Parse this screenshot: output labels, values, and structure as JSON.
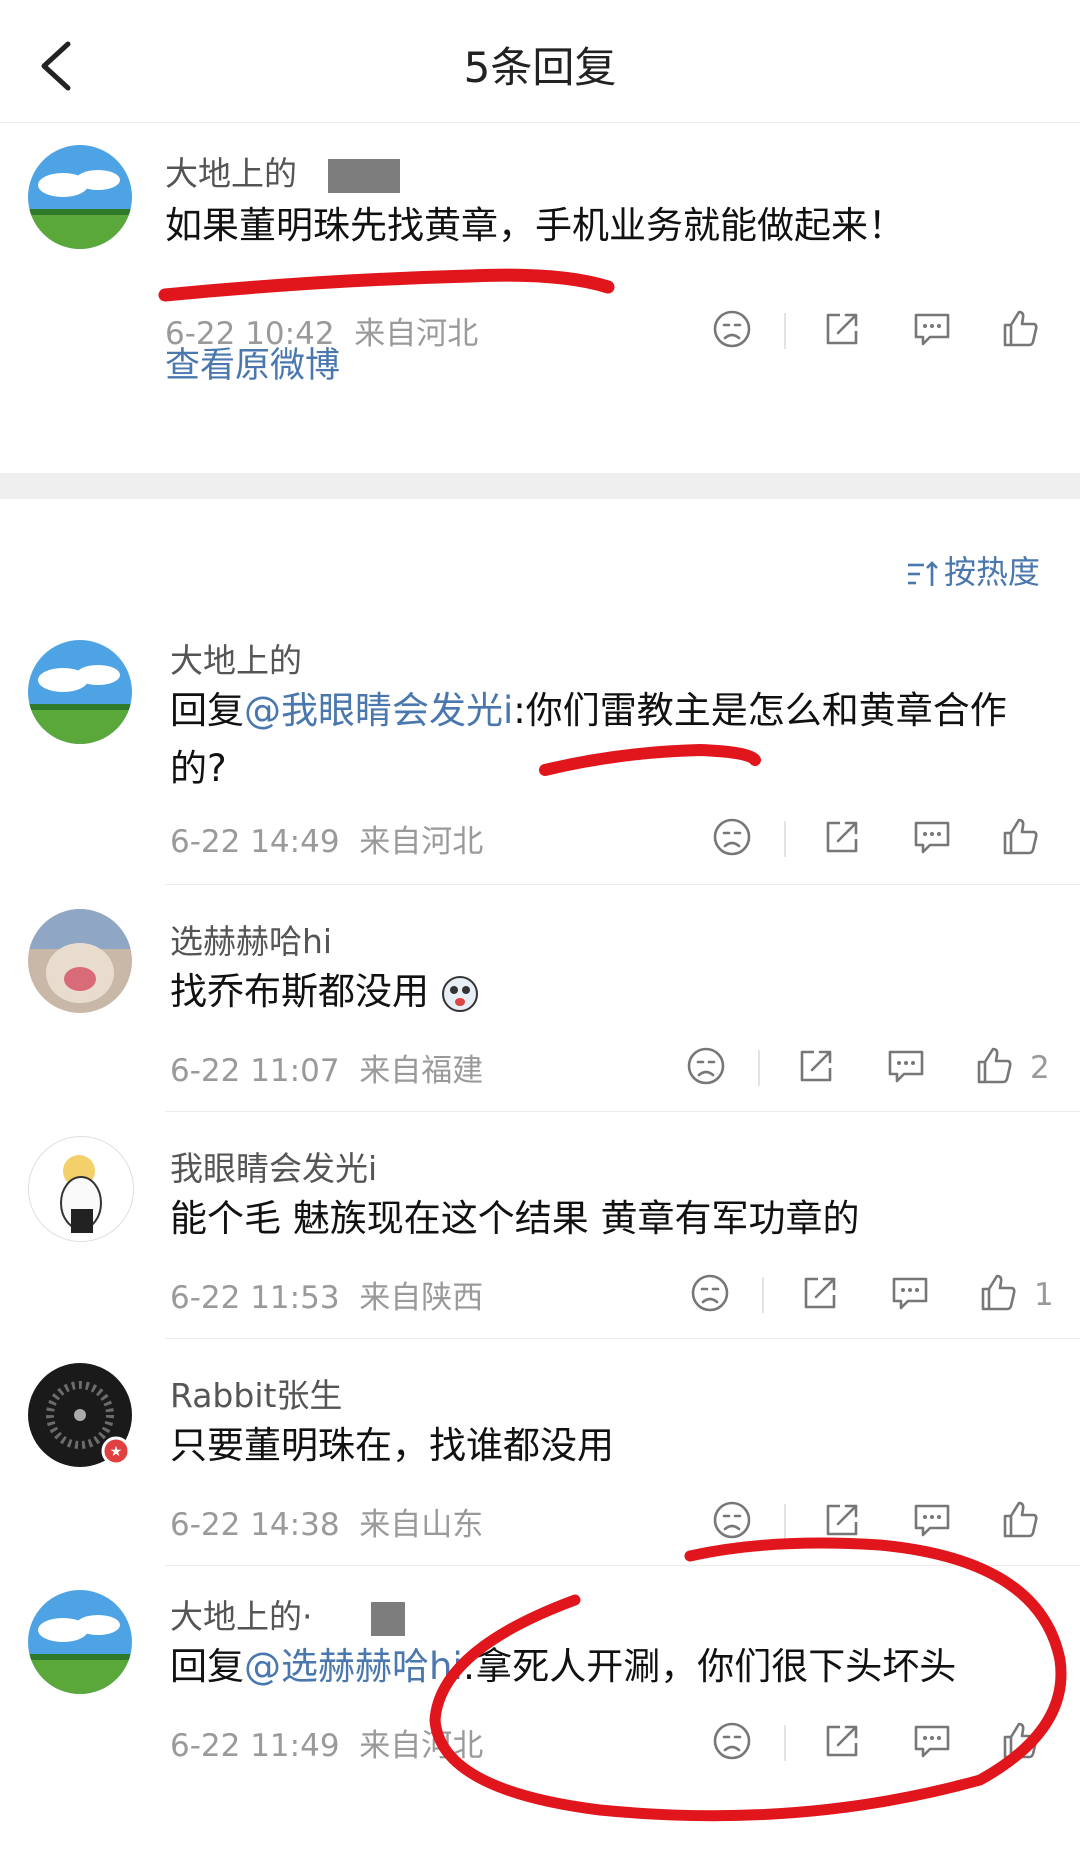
{
  "header": {
    "title": "5条回复"
  },
  "post": {
    "username": "大地上的",
    "content": "如果董明珠先找黄章，手机业务就能做起来！",
    "time": "6-22 10:42",
    "location": "来自河北",
    "view_original": "查看原微博"
  },
  "sort": {
    "label": "按热度"
  },
  "replies": [
    {
      "username": "大地上的",
      "reply_prefix": "回复",
      "mention": "@我眼睛会发光i",
      "content": ":你们雷教主是怎么和黄章合作",
      "content2": "的?",
      "time": "6-22 14:49",
      "location": "来自河北",
      "likes": ""
    },
    {
      "username": "选赫赫哈hi",
      "content": "找乔布斯都没用",
      "time": "6-22 11:07",
      "location": "来自福建",
      "likes": "2"
    },
    {
      "username": "我眼睛会发光i",
      "content": "能个毛 魅族现在这个结果 黄章有军功章的",
      "time": "6-22 11:53",
      "location": "来自陕西",
      "likes": "1"
    },
    {
      "username": "Rabbit张生",
      "content": "只要董明珠在，找谁都没用",
      "time": "6-22 14:38",
      "location": "来自山东",
      "likes": ""
    },
    {
      "username": "大地上的·",
      "reply_prefix": "回复",
      "mention": "@选赫赫哈hi",
      "content": ":拿死人开涮，你们很下头坏头",
      "time": "6-22 11:49",
      "location": "来自河北",
      "likes": ""
    }
  ],
  "colors": {
    "link": "#4a77ad",
    "annotation": "#e0161c",
    "meta": "#9a9a9a"
  }
}
